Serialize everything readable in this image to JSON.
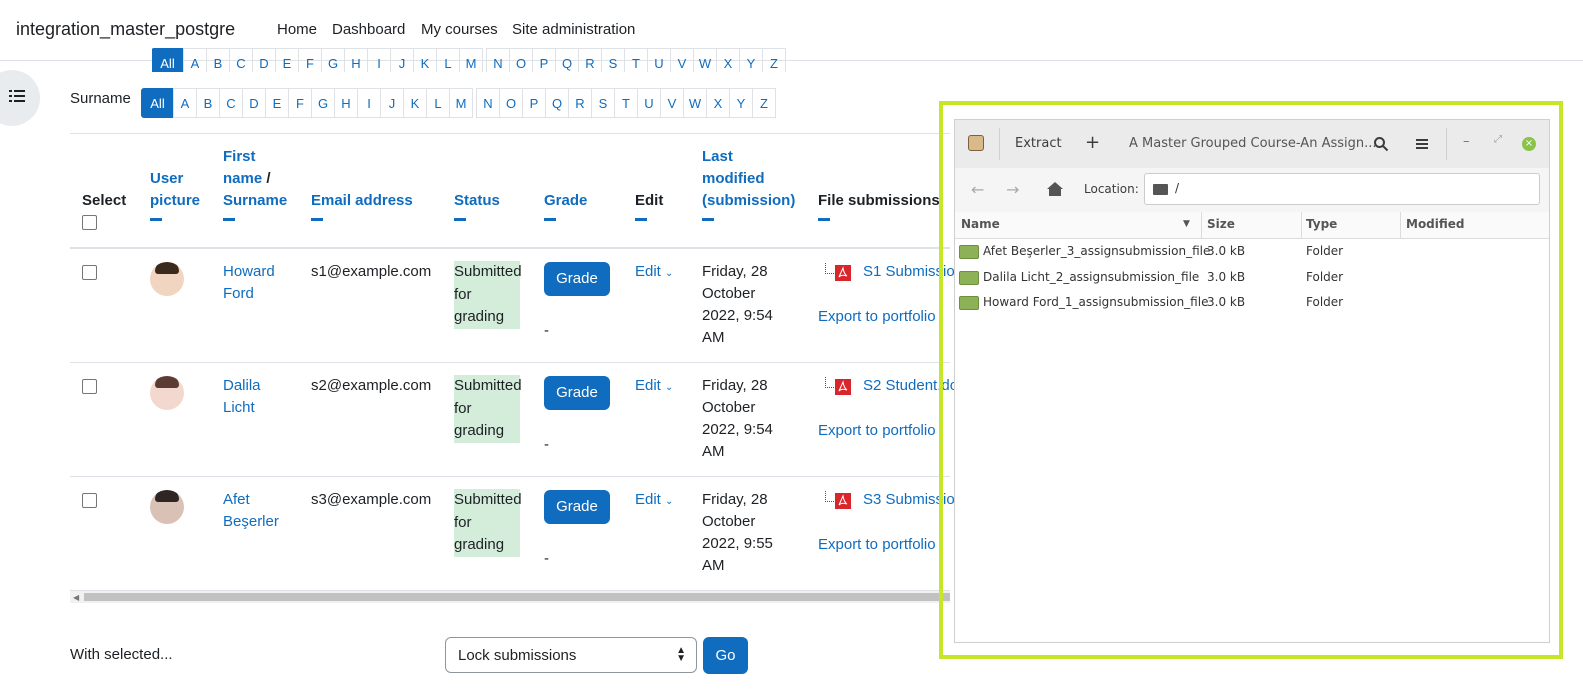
{
  "site": {
    "name": "integration_master_postgre"
  },
  "nav": {
    "home": "Home",
    "dashboard": "Dashboard",
    "my_courses": "My courses",
    "site_admin": "Site administration"
  },
  "filter": {
    "surname_label": "Surname",
    "letters": [
      "All",
      "A",
      "B",
      "C",
      "D",
      "E",
      "F",
      "G",
      "H",
      "I",
      "J",
      "K",
      "L",
      "M",
      "N",
      "O",
      "P",
      "Q",
      "R",
      "S",
      "T",
      "U",
      "V",
      "W",
      "X",
      "Y",
      "Z"
    ]
  },
  "table": {
    "headers": {
      "select": "Select",
      "user_picture_1": "User",
      "user_picture_2": "picture",
      "name_1": "First",
      "name_2": "name",
      "name_slash": "/",
      "name_3": "Surname",
      "email": "Email address",
      "status": "Status",
      "grade": "Grade",
      "edit": "Edit",
      "modified_1": "Last",
      "modified_2": "modified",
      "modified_3": "(submission)",
      "files": "File submissions"
    },
    "rows": [
      {
        "first": "Howard",
        "last": "Ford",
        "email": "s1@example.com",
        "status_1": "Submitted",
        "status_2": "for",
        "status_3": "grading",
        "grade_btn": "Grade",
        "grade_value": "-",
        "edit": "Edit",
        "mod_1": "Friday, 28",
        "mod_2": "October",
        "mod_3": "2022, 9:54",
        "mod_4": "AM",
        "file": "S1 Submissio",
        "export": "Export to portfolio"
      },
      {
        "first": "Dalila",
        "last": "Licht",
        "email": "s2@example.com",
        "status_1": "Submitted",
        "status_2": "for",
        "status_3": "grading",
        "grade_btn": "Grade",
        "grade_value": "-",
        "edit": "Edit",
        "mod_1": "Friday, 28",
        "mod_2": "October",
        "mod_3": "2022, 9:54",
        "mod_4": "AM",
        "file": "S2 Student.do",
        "export": "Export to portfolio"
      },
      {
        "first": "Afet",
        "last": "Beşerler",
        "email": "s3@example.com",
        "status_1": "Submitted",
        "status_2": "for",
        "status_3": "grading",
        "grade_btn": "Grade",
        "grade_value": "-",
        "edit": "Edit",
        "mod_1": "Friday, 28",
        "mod_2": "October",
        "mod_3": "2022, 9:55",
        "mod_4": "AM",
        "file": "S3 Submissio",
        "export": "Export to portfolio"
      }
    ]
  },
  "bulk": {
    "label": "With selected...",
    "select_value": "Lock submissions",
    "go": "Go"
  },
  "archive": {
    "extract": "Extract",
    "add": "+",
    "title": "A Master Grouped Course-An Assign...",
    "location_label": "Location:",
    "location_value": "/",
    "columns": {
      "name": "Name",
      "size": "Size",
      "type": "Type",
      "modified": "Modified"
    },
    "files": [
      {
        "name": "Afet Beşerler_3_assignsubmission_file",
        "size": "3.0 kB",
        "type": "Folder",
        "modified": ""
      },
      {
        "name": "Dalila Licht_2_assignsubmission_file",
        "size": "3.0 kB",
        "type": "Folder",
        "modified": ""
      },
      {
        "name": "Howard Ford_1_assignsubmission_file",
        "size": "3.0 kB",
        "type": "Folder",
        "modified": ""
      }
    ]
  },
  "colors": {
    "primary": "#0f6cbf",
    "status_bg": "#d4edda",
    "highlight": "#c6e628",
    "folder": "#8cb156"
  }
}
